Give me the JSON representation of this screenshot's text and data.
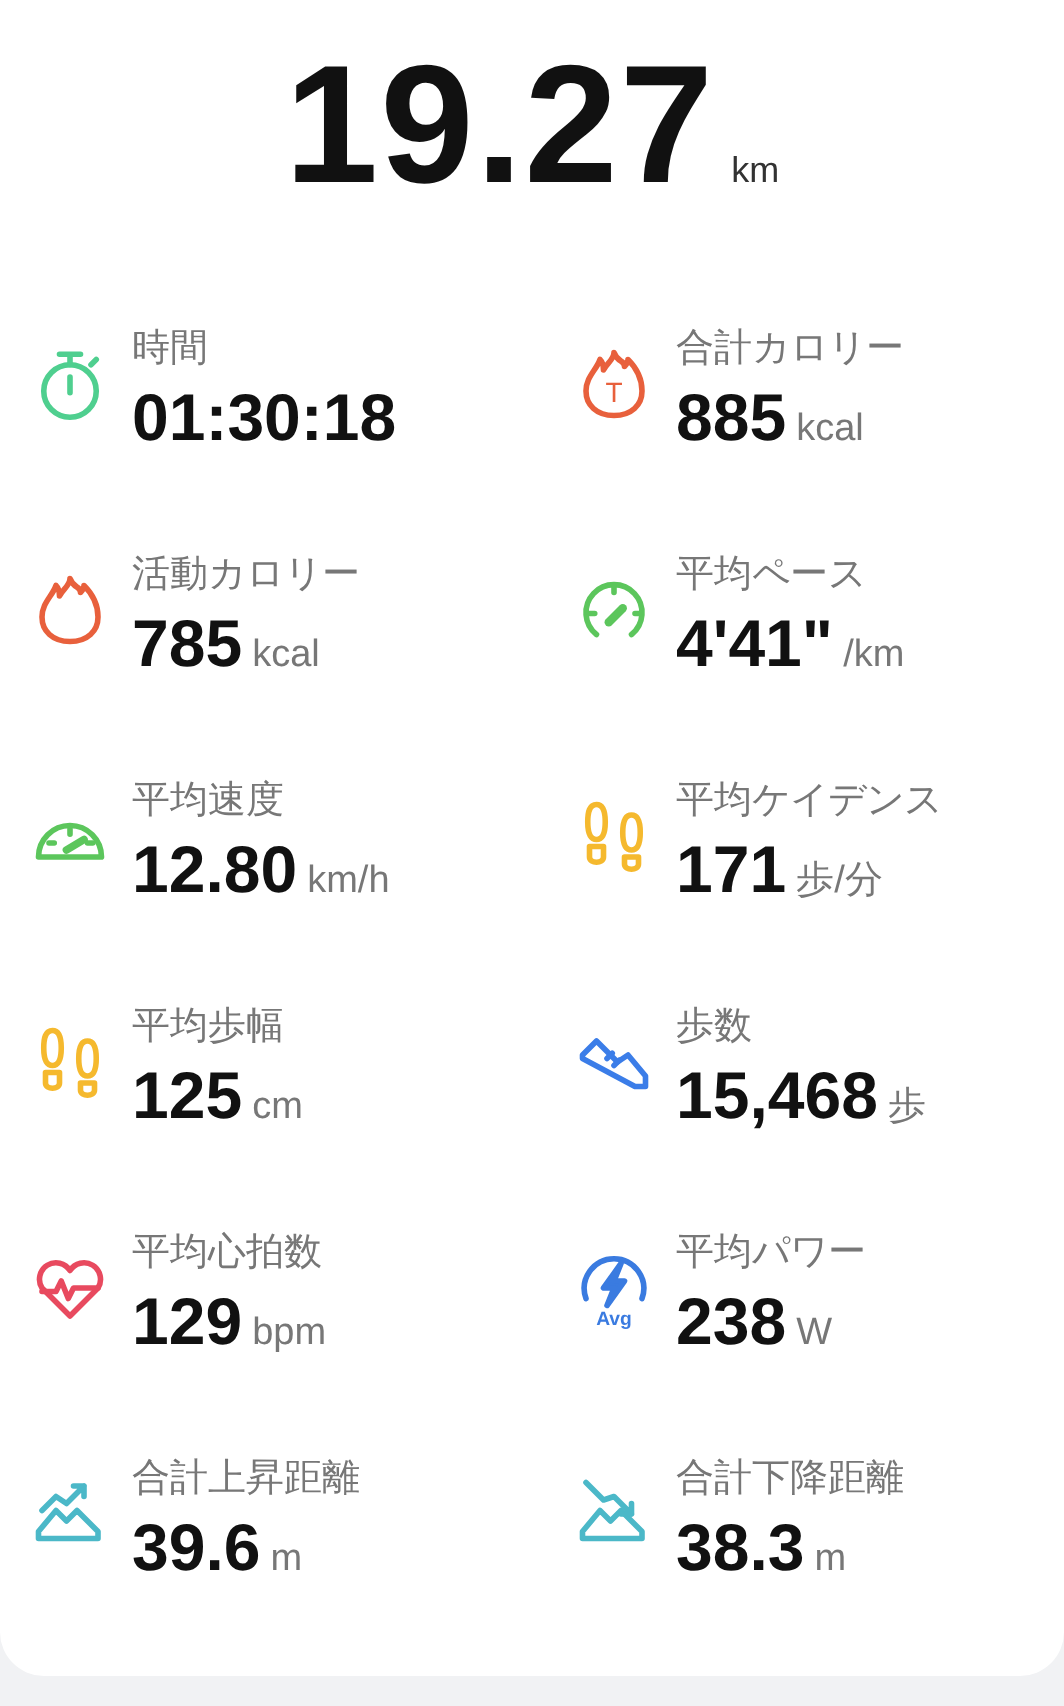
{
  "distance": {
    "value": "19.27",
    "unit": "km"
  },
  "metrics": [
    {
      "kind": "stopwatch",
      "color": "#4fcf8f",
      "label": "時間",
      "value": "01:30:18"
    },
    {
      "kind": "flame",
      "color": "#e8603c",
      "icon_label": "T",
      "label": "合計カロリー",
      "value": "885",
      "unit": "kcal"
    },
    {
      "kind": "flame",
      "color": "#e8603c",
      "label": "活動カロリー",
      "value": "785",
      "unit": "kcal"
    },
    {
      "kind": "gauge",
      "color": "#5cc65c",
      "label": "平均ペース",
      "value": "4'41\"",
      "unit": "/km"
    },
    {
      "kind": "speedometer",
      "color": "#5cc65c",
      "label": "平均速度",
      "value": "12.80",
      "unit": "km/h"
    },
    {
      "kind": "footprints",
      "color": "#f5b92e",
      "label": "平均ケイデンス",
      "value": "171",
      "unit": "歩/分"
    },
    {
      "kind": "footprints",
      "color": "#f5b92e",
      "label": "平均歩幅",
      "value": "125",
      "unit": "cm"
    },
    {
      "kind": "shoe",
      "color": "#3b7de8",
      "label": "歩数",
      "value": "15,468",
      "unit": "歩"
    },
    {
      "kind": "heart",
      "color": "#e84a5f",
      "label": "平均心拍数",
      "value": "129",
      "unit": "bpm"
    },
    {
      "kind": "bolt",
      "color": "#3a7be0",
      "icon_label": "Avg",
      "label": "平均パワー",
      "value": "238",
      "unit": "W"
    },
    {
      "kind": "climb",
      "color": "#4bb8c8",
      "label": "合計上昇距離",
      "value": "39.6",
      "unit": "m"
    },
    {
      "kind": "descent",
      "color": "#4bb8c8",
      "label": "合計下降距離",
      "value": "38.3",
      "unit": "m"
    }
  ]
}
